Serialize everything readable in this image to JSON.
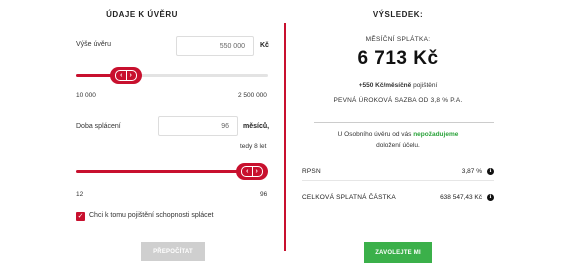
{
  "loan": {
    "heading": "ÚDAJE K ÚVĚRU",
    "amount": {
      "label": "Výše úvěru",
      "value": "550 000",
      "unit": "Kč",
      "min_label": "10 000",
      "max_label": "2 500 000",
      "slider_fraction": 0.22
    },
    "term": {
      "label": "Doba splácení",
      "value": "96",
      "unit": "měsíců,",
      "note": "tedy 8 let",
      "min_label": "12",
      "max_label": "96",
      "slider_fraction": 1.0
    },
    "insurance_checkbox": {
      "label": "Chci k tomu pojištění schopnosti splácet",
      "checked": true
    },
    "recalculate_button": "PŘEPOČÍTAT",
    "accent_color": "#c8102e"
  },
  "result": {
    "heading": "VÝSLEDEK:",
    "monthly_label": "MĚSÍČNÍ SPLÁTKA:",
    "monthly_amount": "6 713 Kč",
    "insurance_bold": "+550 Kč/měsíčně",
    "insurance_rest": "pojištění",
    "rate_text": "PEVNÁ ÚROKOVÁ SAZBA OD 3,8 % P.A.",
    "no_proof_1": "U Osobního úvěru od vás",
    "no_proof_highlight": "nepožadujeme",
    "no_proof_2": "doložení účelu.",
    "rpsn_label": "RPSN",
    "rpsn_value": "3,87 %",
    "total_label": "CELKOVÁ SPLATNÁ ČÁSTKA",
    "total_value": "638 547,43 Kč",
    "call_button": "ZAVOLEJTE MI",
    "cta_color": "#3bb04a"
  }
}
